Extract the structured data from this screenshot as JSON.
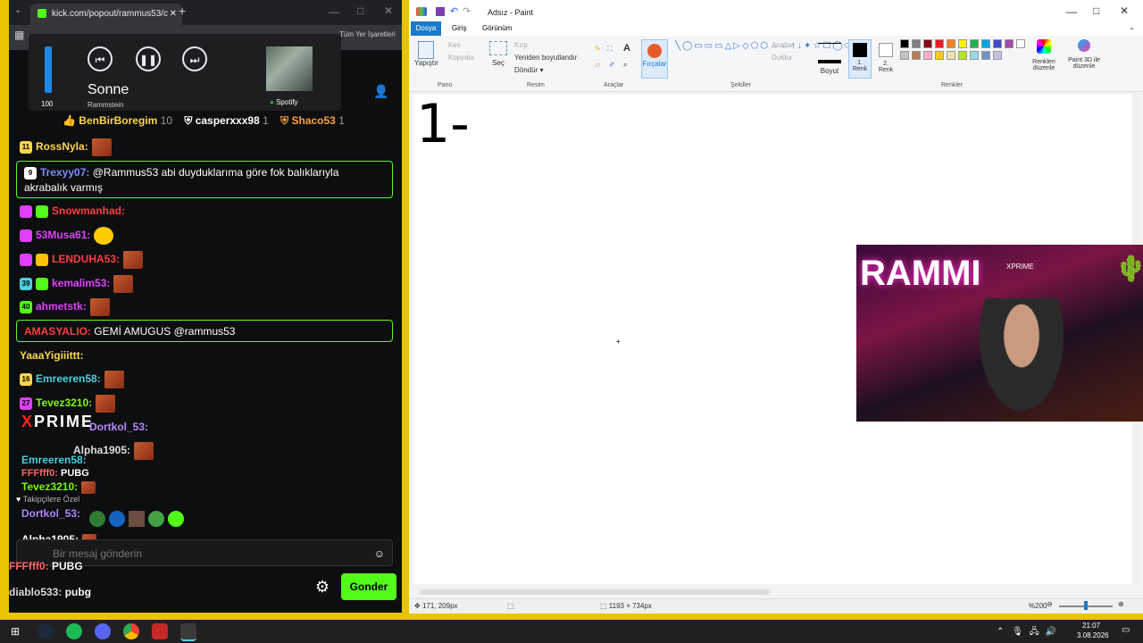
{
  "browser": {
    "tab_title": "kick.com/popout/rammus53/c",
    "new_tab": "+",
    "address_partial": "Tüm Yer İşaretleri"
  },
  "media": {
    "volume": "100",
    "volume_level": 1.0,
    "track": "Sonne",
    "artist": "Rammstein",
    "source": "Spotify"
  },
  "chat": {
    "pinned": [
      {
        "user": "BenBirBoregim",
        "count": "10"
      },
      {
        "user": "casperxxx98",
        "count": "1"
      },
      {
        "user": "Shaco53",
        "count": "1"
      }
    ],
    "messages": [
      {
        "badge": "11",
        "user": "RossNyla:",
        "color": "#ffd54f",
        "text": ""
      },
      {
        "badge": "9",
        "user": "Trexyy07:",
        "color": "#7c8cff",
        "text": "@Rammus53 abi duyduklarıma göre fok balıklarıyla akrabalık varmış",
        "highlight": true
      },
      {
        "badge": "",
        "user": "Snowmanhad:",
        "color": "#ff3d3d",
        "text": ""
      },
      {
        "badge": "",
        "user": "53Musa61:",
        "color": "#e040fb",
        "text": ""
      },
      {
        "badge": "",
        "user": "LENDUHA53:",
        "color": "#ff3d3d",
        "text": ""
      },
      {
        "badge": "39",
        "user": "kemalim53:",
        "color": "#e040fb",
        "text": ""
      },
      {
        "badge": "40",
        "user": "ahmetstk:",
        "color": "#e040fb",
        "text": ""
      },
      {
        "badge": "",
        "user": "AMASYALIO:",
        "color": "#ff3d3d",
        "text": "GEMİ AMUGUS @rammus53",
        "highlight": true
      },
      {
        "badge": "",
        "user": "YaaaYigiiittt:",
        "color": "#ffd54f",
        "text": ""
      },
      {
        "badge": "16",
        "user": "Emreeren58:",
        "color": "#4dd0e1",
        "text": ""
      },
      {
        "badge": "27",
        "user": "Tevez3210:",
        "color": "#7cfc00",
        "text": ""
      },
      {
        "badge": "",
        "user": "Dortkol_53:",
        "color": "#b388ff",
        "text": ""
      },
      {
        "badge": "",
        "user": "Alpha1905:",
        "color": "#dddddd",
        "text": ""
      }
    ],
    "overlay_messages": [
      {
        "user": "Emreeren58:",
        "text": "",
        "color": "#4dd0e1"
      },
      {
        "user": "FFFfff0:",
        "text": "PUBG",
        "color": "#ff6b6b"
      },
      {
        "user": "Tevez3210:",
        "text": "",
        "color": "#7cfc00"
      },
      {
        "user": "",
        "text": "Takipçilere Özel",
        "color": "#bbbbbb"
      },
      {
        "user": "Dortkol_53:",
        "text": "",
        "color": "#b388ff"
      },
      {
        "user": "Alpha1905:",
        "text": "",
        "color": "#ffffff"
      },
      {
        "user": "FFFfff0:",
        "text": "PUBG",
        "color": "#ff6b6b"
      },
      {
        "user": "diablo533:",
        "text": "pubg",
        "color": "#dddddd"
      }
    ],
    "input_placeholder": "Bir mesaj gönderin",
    "send_label": "Gonder"
  },
  "paint": {
    "title": "Adsız - Paint",
    "tabs": [
      "Dosya",
      "Giriş",
      "Görünüm"
    ],
    "clipboard": {
      "paste": "Yapıştır",
      "cut": "Kes",
      "copy": "Kopyala",
      "group": "Pano"
    },
    "image": {
      "select": "Seç",
      "crop": "Kırp",
      "resize": "Yeniden boyutlandır",
      "rotate": "Döndür",
      "group": "Resim"
    },
    "tools_group": "Araçlar",
    "brushes": "Fırçalar",
    "shapes": {
      "outline": "Anahat",
      "fill": "Doldur",
      "group": "Şekiller"
    },
    "size": "Boyut",
    "color1": "1. Renk",
    "color2": "2. Renk",
    "colors_group": "Renkler",
    "edit_colors": "Renkleri düzenle",
    "paint3d": "Paint 3D ile düzenle",
    "canvas_drawing": "1-",
    "status_pos": "171, 209px",
    "status_size": "1193 × 734px",
    "zoom": "%200",
    "palette": [
      "#000000",
      "#7f7f7f",
      "#880015",
      "#ed1c24",
      "#ff7f27",
      "#fff200",
      "#22b14c",
      "#00a2e8",
      "#3f48cc",
      "#a349a4",
      "#ffffff",
      "#c3c3c3",
      "#b97a57",
      "#ffaec9",
      "#ffc90e",
      "#efe4b0",
      "#b5e61d",
      "#99d9ea",
      "#7092be",
      "#c8bfe7"
    ]
  },
  "webcam": {
    "overlay_text": "RAMMI",
    "brand": "XPRIME"
  },
  "taskbar": {
    "time": "21:07",
    "date": "3.08.2026"
  }
}
